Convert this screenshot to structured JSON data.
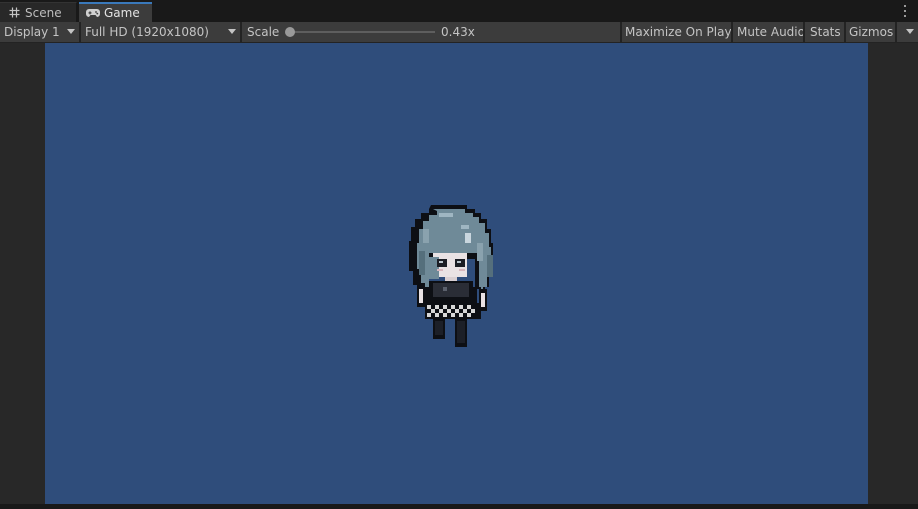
{
  "tabs": {
    "scene": {
      "label": "Scene",
      "icon": "grid-hash-icon"
    },
    "game": {
      "label": "Game",
      "icon": "gamepad-icon",
      "active": true
    }
  },
  "toolbar": {
    "display": "Display 1",
    "resolution": "Full HD (1920x1080)",
    "scale_label": "Scale",
    "scale_value": "0.43x",
    "maximize": "Maximize On Play",
    "mute": "Mute Audio",
    "stats": "Stats",
    "gizmos": "Gizmos"
  },
  "colors": {
    "game_background": "#2f4d7b",
    "editor_background": "#282828",
    "toolbar_background": "#3c3c3c",
    "active_tab_accent": "#3a79bb"
  }
}
